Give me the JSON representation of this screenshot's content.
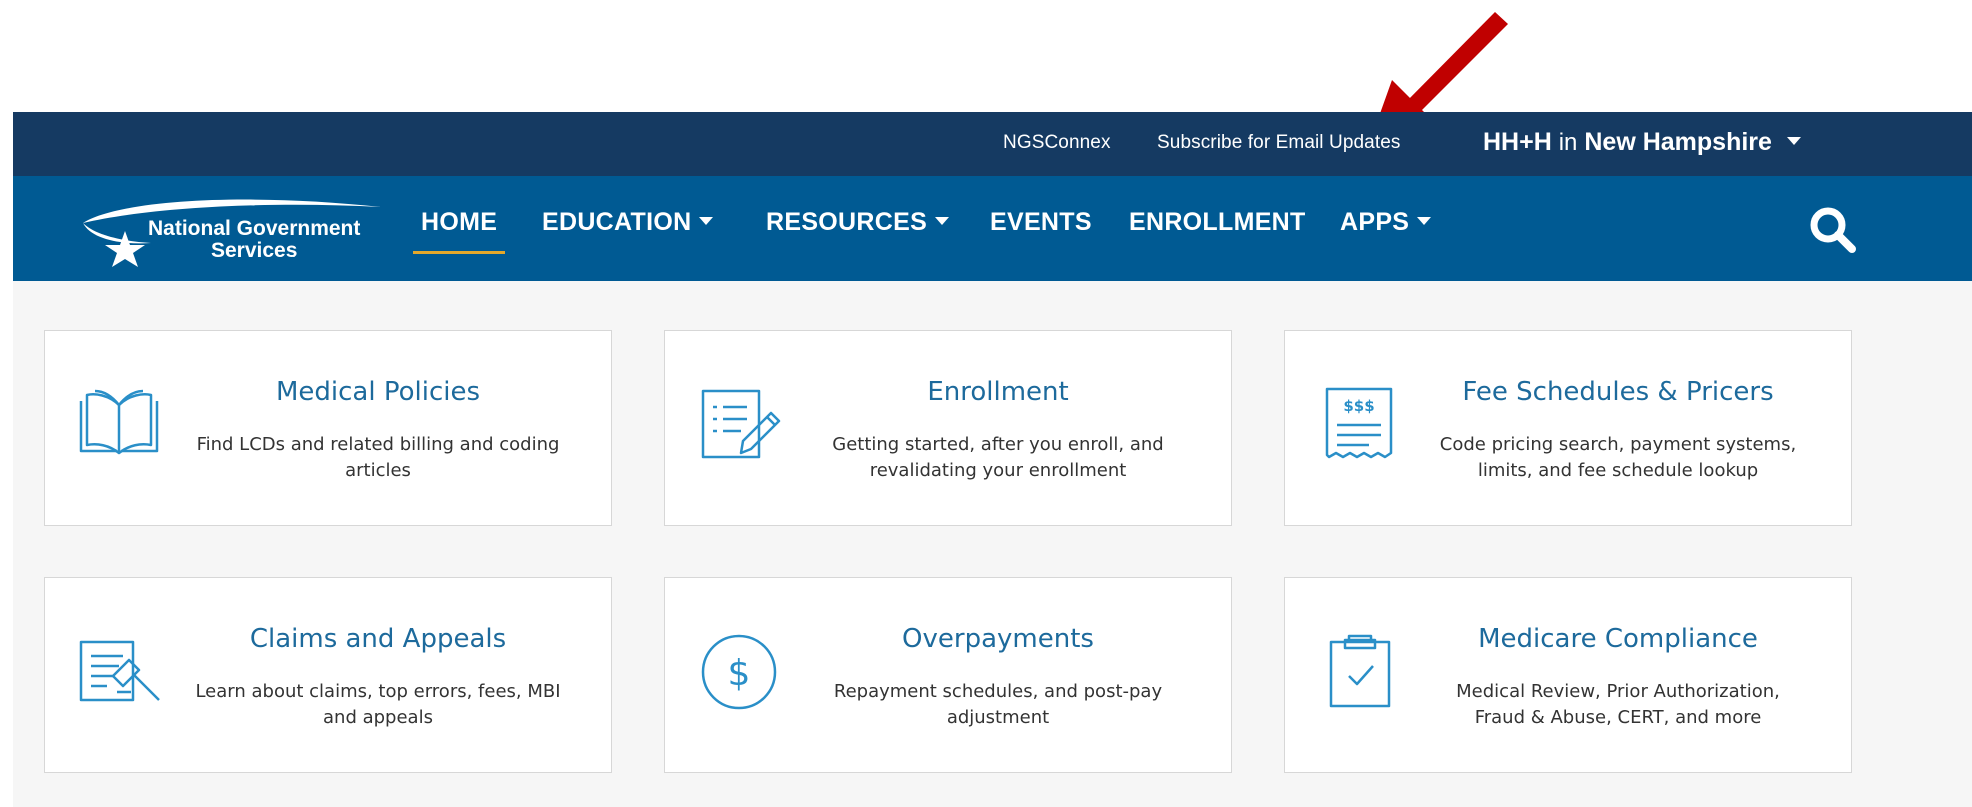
{
  "topbar": {
    "links": [
      "NGSConnex",
      "Subscribe for Email Updates"
    ],
    "state_selector": {
      "line": "HH+H",
      "in_text": "in",
      "state": "New Hampshire"
    }
  },
  "nav": {
    "logo": {
      "line1": "National Government",
      "line2": "Services"
    },
    "items": [
      {
        "label": "HOME",
        "active": true
      },
      {
        "label": "EDUCATION",
        "dropdown": true
      },
      {
        "label": "RESOURCES",
        "dropdown": true
      },
      {
        "label": "EVENTS"
      },
      {
        "label": "ENROLLMENT"
      },
      {
        "label": "APPS",
        "dropdown": true
      }
    ]
  },
  "cards": [
    {
      "icon": "open-book-icon",
      "title": "Medical Policies",
      "desc_line1": "Find LCDs and related billing and coding",
      "desc_line2": "articles"
    },
    {
      "icon": "document-pencil-icon",
      "title": "Enrollment",
      "desc_line1": "Getting started, after you enroll, and",
      "desc_line2": "revalidating your enrollment"
    },
    {
      "icon": "receipt-dollar-icon",
      "title": "Fee Schedules & Pricers",
      "desc_line1": "Code pricing search, payment systems,",
      "desc_line2": "limits, and fee schedule lookup"
    },
    {
      "icon": "document-gavel-icon",
      "title": "Claims and Appeals",
      "desc_line1": "Learn about claims, top errors, fees, MBI",
      "desc_line2": "and appeals"
    },
    {
      "icon": "dollar-circle-icon",
      "title": "Overpayments",
      "desc_line1": "Repayment schedules, and post-pay",
      "desc_line2": "adjustment"
    },
    {
      "icon": "clipboard-check-icon",
      "title": "Medicare Compliance",
      "desc_line1": "Medical Review, Prior Authorization,",
      "desc_line2": "Fraud & Abuse, CERT, and more"
    }
  ],
  "icons": {
    "search": "search-icon",
    "annotation": "red-arrow-icon"
  },
  "colors": {
    "topbar": "#153a62",
    "navbar": "#005a93",
    "accent": "#e4a82b",
    "card_title": "#1d6a9c",
    "icon_stroke": "#2a8fc8",
    "arrow": "#c00000"
  }
}
